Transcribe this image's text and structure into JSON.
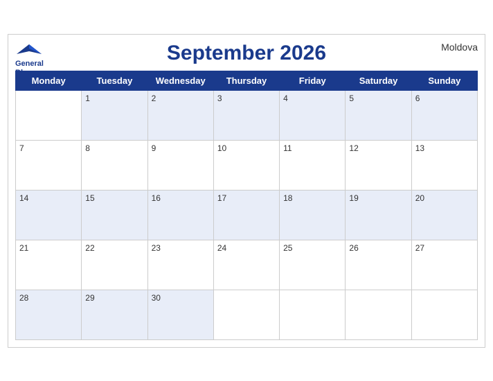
{
  "header": {
    "title": "September 2026",
    "country": "Moldova",
    "logo_line1": "General",
    "logo_line2": "Blue"
  },
  "weekdays": [
    "Monday",
    "Tuesday",
    "Wednesday",
    "Thursday",
    "Friday",
    "Saturday",
    "Sunday"
  ],
  "weeks": [
    [
      "",
      "1",
      "2",
      "3",
      "4",
      "5",
      "6"
    ],
    [
      "7",
      "8",
      "9",
      "10",
      "11",
      "12",
      "13"
    ],
    [
      "14",
      "15",
      "16",
      "17",
      "18",
      "19",
      "20"
    ],
    [
      "21",
      "22",
      "23",
      "24",
      "25",
      "26",
      "27"
    ],
    [
      "28",
      "29",
      "30",
      "",
      "",
      "",
      ""
    ]
  ]
}
